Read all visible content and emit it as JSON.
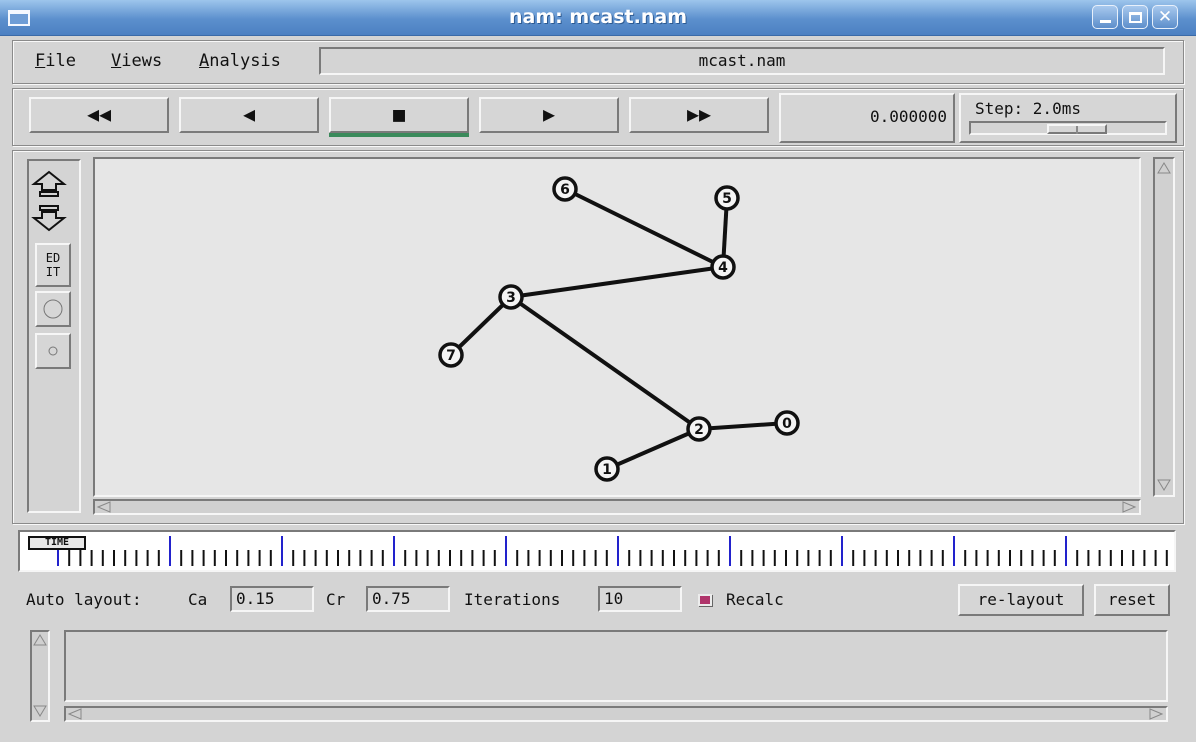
{
  "window": {
    "title": "nam: mcast.nam",
    "icons": [
      "window-menu-icon",
      "minimize-icon",
      "maximize-icon",
      "close-icon"
    ]
  },
  "menu": {
    "items": [
      "File",
      "Views",
      "Analysis"
    ],
    "filename": "mcast.nam"
  },
  "controls": {
    "rewind": "◀◀",
    "back": "◀",
    "stop": "■",
    "play": "▶",
    "fast_forward": "▶▶",
    "active": "stop",
    "active_color": "#3a8a5b",
    "time": "0.000000",
    "step_label": "Step: 2.0ms"
  },
  "tools": {
    "edit_label_top": "ED",
    "edit_label_bottom": "IT",
    "items": [
      "zoom-in-icon",
      "zoom-out-icon",
      "edit-button",
      "large-circle-icon",
      "small-circle-icon"
    ]
  },
  "topology": {
    "nodes": [
      {
        "id": "0",
        "label": "0"
      },
      {
        "id": "1",
        "label": "1"
      },
      {
        "id": "2",
        "label": "2"
      },
      {
        "id": "3",
        "label": "3"
      },
      {
        "id": "4",
        "label": "4"
      },
      {
        "id": "5",
        "label": "5"
      },
      {
        "id": "6",
        "label": "6"
      },
      {
        "id": "7",
        "label": "7"
      }
    ],
    "links": [
      [
        "6",
        "4"
      ],
      [
        "5",
        "4"
      ],
      [
        "4",
        "3"
      ],
      [
        "3",
        "7"
      ],
      [
        "3",
        "2"
      ],
      [
        "2",
        "0"
      ],
      [
        "2",
        "1"
      ]
    ]
  },
  "timeline": {
    "label": "TIME",
    "major_tick_color": "#2222cc",
    "minor_per_major": 10
  },
  "auto_layout": {
    "label": "Auto layout:",
    "ca_label": "Ca",
    "ca_value": "0.15",
    "cr_label": "Cr",
    "cr_value": "0.75",
    "iterations_label": "Iterations",
    "iterations_value": "10",
    "recalc_label": "Recalc",
    "recalc_color": "#b0356b",
    "relayout_button": "re-layout",
    "reset_button": "reset"
  }
}
